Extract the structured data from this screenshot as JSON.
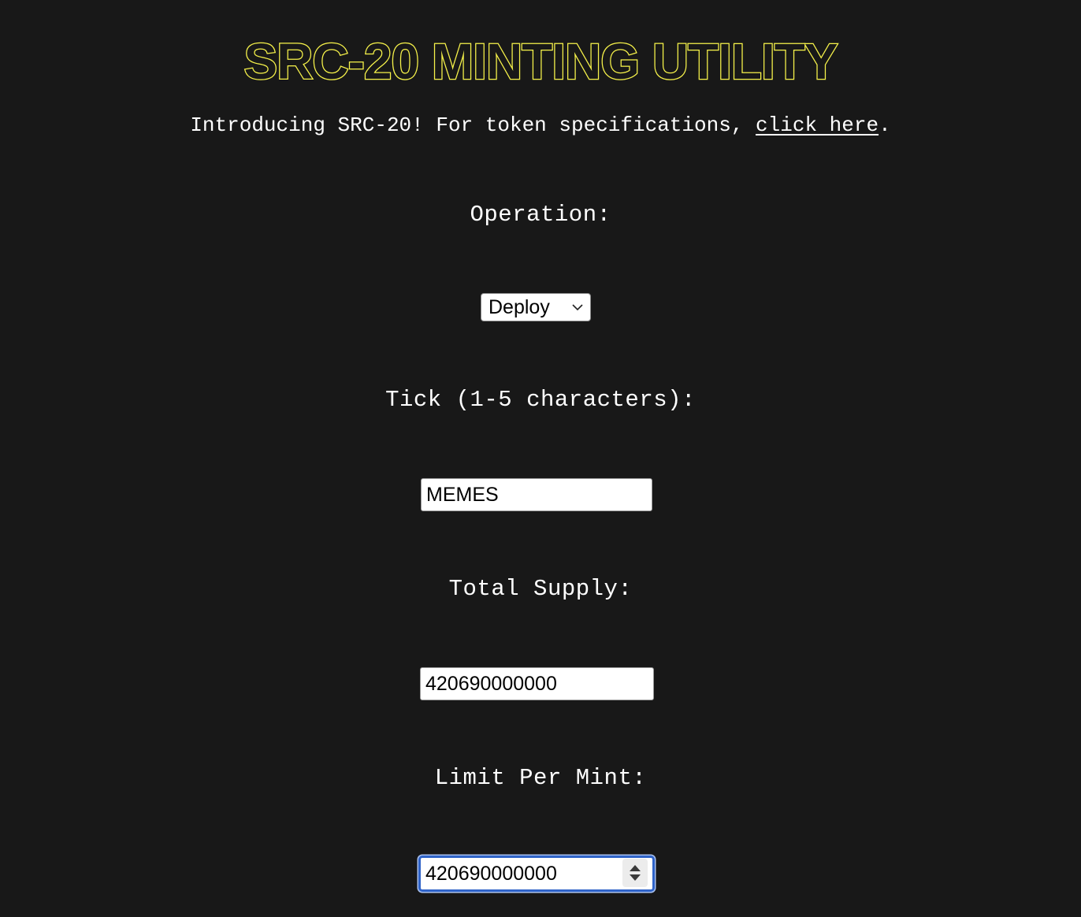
{
  "header": {
    "title": "SRC-20 MINTING UTILITY",
    "intro_prefix": "Introducing SRC-20! For token specifications, ",
    "intro_link": "click here",
    "intro_suffix": "."
  },
  "form": {
    "operation": {
      "label": "Operation:",
      "selected": "Deploy"
    },
    "tick": {
      "label": "Tick (1-5 characters):",
      "value": "MEMES"
    },
    "total_supply": {
      "label": "Total Supply:",
      "value": "420690000000"
    },
    "limit_per_mint": {
      "label": "Limit Per Mint:",
      "value": "420690000000"
    }
  },
  "colors": {
    "background": "#181818",
    "title_outline": "#f6f24a",
    "focus_ring": "#2f63c8"
  },
  "icons": {
    "select_arrow": "chevron-down-icon",
    "stepper": "spinner-arrows-icon"
  }
}
